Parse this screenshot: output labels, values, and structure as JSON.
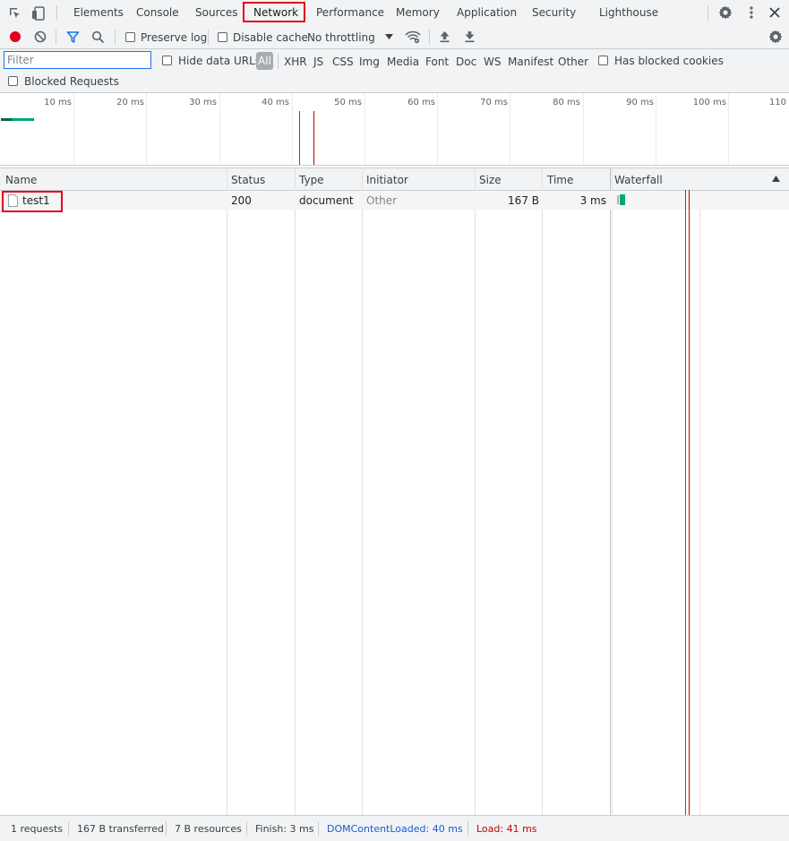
{
  "tabs": {
    "elements": "Elements",
    "console": "Console",
    "sources": "Sources",
    "network": "Network",
    "performance": "Performance",
    "memory": "Memory",
    "application": "Application",
    "security": "Security",
    "lighthouse": "Lighthouse"
  },
  "toolbar": {
    "preserve_log": "Preserve log",
    "disable_cache": "Disable cache",
    "throttling": "No throttling"
  },
  "filter": {
    "placeholder": "Filter",
    "hide_data_urls": "Hide data URLs",
    "types": [
      "All",
      "XHR",
      "JS",
      "CSS",
      "Img",
      "Media",
      "Font",
      "Doc",
      "WS",
      "Manifest",
      "Other"
    ],
    "has_blocked_cookies": "Has blocked cookies",
    "blocked_requests": "Blocked Requests"
  },
  "overview": {
    "ticks": [
      "10 ms",
      "20 ms",
      "30 ms",
      "40 ms",
      "50 ms",
      "60 ms",
      "70 ms",
      "80 ms",
      "90 ms",
      "100 ms",
      "110"
    ]
  },
  "table": {
    "headers": {
      "name": "Name",
      "status": "Status",
      "type": "Type",
      "initiator": "Initiator",
      "size": "Size",
      "time": "Time",
      "waterfall": "Waterfall"
    },
    "rows": [
      {
        "name": "test1",
        "status": "200",
        "type": "document",
        "initiator": "Other",
        "size": "167 B",
        "time": "3 ms"
      }
    ]
  },
  "status": {
    "requests": "1 requests",
    "transferred": "167 B transferred",
    "resources": "7 B resources",
    "finish": "Finish: 3 ms",
    "dom_content_loaded": "DOMContentLoaded: 40 ms",
    "load": "Load: 41 ms"
  },
  "colors": {
    "record": "#e0001b",
    "highlight": "#e0001b",
    "filter_icon": "#1a73e8",
    "dom_line": "#1a5bd6",
    "load_line": "#c80000",
    "waiting_bar": "#00a87b"
  },
  "icons": [
    "inspect-icon",
    "device-toggle-icon",
    "settings-gear-icon",
    "kebab-menu-icon",
    "close-icon",
    "record-icon",
    "clear-icon",
    "filter-icon",
    "search-icon",
    "dropdown-arrow-icon",
    "network-conditions-icon",
    "import-har-icon",
    "export-har-icon",
    "network-settings-icon",
    "document-file-icon",
    "sort-asc-icon"
  ]
}
